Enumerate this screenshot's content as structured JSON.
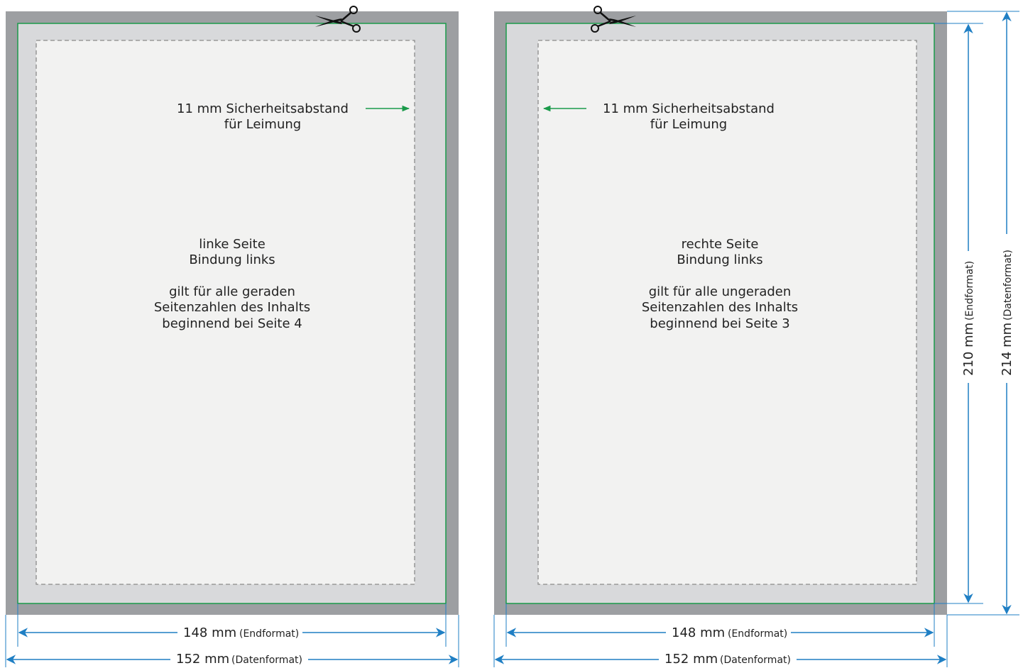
{
  "left_page": {
    "safety_line1": "11 mm Sicherheitsabstand",
    "safety_line2": "für Leimung",
    "label_line1": "linke Seite",
    "label_line2": "Bindung links",
    "label_line3": "gilt für alle geraden",
    "label_line4": "Seitenzahlen des Inhalts",
    "label_line5": "beginnend bei Seite 4",
    "width_end_value": "148 mm",
    "width_end_unit": "(Endformat)",
    "width_data_value": "152 mm",
    "width_data_unit": "(Datenformat)"
  },
  "right_page": {
    "safety_line1": "11 mm Sicherheitsabstand",
    "safety_line2": "für Leimung",
    "label_line1": "rechte Seite",
    "label_line2": "Bindung links",
    "label_line3": "gilt für alle ungeraden",
    "label_line4": "Seitenzahlen des Inhalts",
    "label_line5": "beginnend bei Seite 3",
    "width_end_value": "148 mm",
    "width_end_unit": "(Endformat)",
    "width_data_value": "152 mm",
    "width_data_unit": "(Datenformat)",
    "height_end_value": "210 mm",
    "height_end_unit": "(Endformat)",
    "height_data_value": "214 mm",
    "height_data_unit": "(Datenformat)"
  },
  "colors": {
    "bleed": "#9d9fa2",
    "page": "#d8d9db",
    "safe_area": "#f2f2f1",
    "trim_line": "#1a9a4a",
    "dimension": "#1f7fc4"
  },
  "icons": {
    "cut_mark": "scissors-icon"
  }
}
